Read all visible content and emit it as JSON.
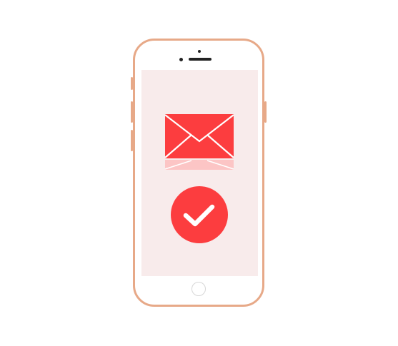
{
  "device": {
    "type": "smartphone",
    "frame_color": "#e7a988",
    "screen_color": "#f8ebeb"
  },
  "screen": {
    "icons": [
      "envelope-icon",
      "check-circle-icon"
    ],
    "accent_color": "#fc3d3f"
  }
}
